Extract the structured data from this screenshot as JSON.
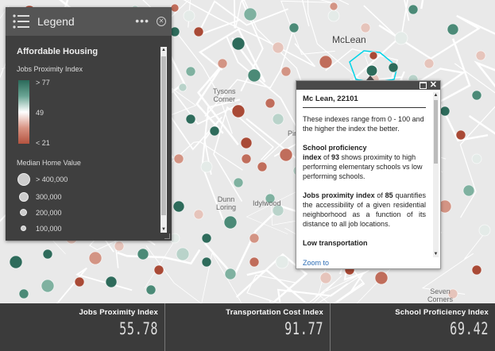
{
  "map": {
    "places": {
      "mclean": "McLean",
      "tysons": "Tysons\nCorner",
      "dunn_loring": "Dunn\nLoring",
      "idylwood": "Idylwood",
      "pimmit": "Pim",
      "seven_corners": "Seven\nCorners"
    },
    "colors": {
      "high": "#2e6b5b",
      "mid": "#dfe7e4",
      "low": "#b85a48",
      "selected": "#00d4e8"
    }
  },
  "legend": {
    "title": "Legend",
    "layer_title": "Affordable Housing",
    "jobs_label": "Jobs Proximity Index",
    "ramp_high": "> 77",
    "ramp_mid": "49",
    "ramp_low": "< 21",
    "home_value_label": "Median Home Value",
    "sizes": [
      "> 400,000",
      "300,000",
      "200,000",
      "100,000"
    ],
    "icons": {
      "list": "list-icon",
      "more": "more-icon",
      "close": "close-icon"
    }
  },
  "popup": {
    "title": "Mc Lean, 22101",
    "intro": "These indexes range from 0 - 100 and the higher the index the better.",
    "school_heading": "School proficiency",
    "school_pre": "index",
    "school_of": " of ",
    "school_value": "93",
    "school_text": " shows proximity to high performing elementary schools vs low performing schools.",
    "jobs_heading": "Jobs proximity index",
    "jobs_of": " of ",
    "jobs_value": "85",
    "jobs_text": " quantifies the accessibility of a given residential neighborhood as a function of its distance to all job locations.",
    "transport_heading": "Low transportation",
    "zoom_link": "Zoom to"
  },
  "stats": [
    {
      "label": "Jobs Proximity Index",
      "value": "55.78"
    },
    {
      "label": "Transportation Cost Index",
      "value": "91.77"
    },
    {
      "label": "School Proficiency Index",
      "value": "69.42"
    }
  ]
}
